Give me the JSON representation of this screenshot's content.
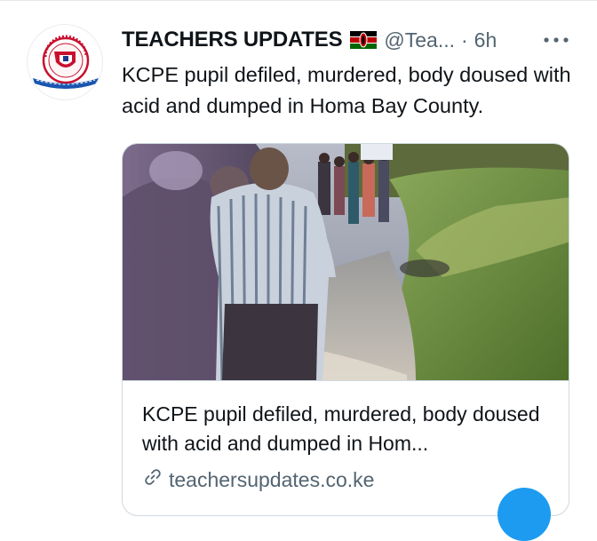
{
  "tweet": {
    "author_name": "TEACHERS UPDATES",
    "author_handle": "@Tea...",
    "separator": "·",
    "time": "6h",
    "text": "KCPE pupil defiled, murdered, body doused with acid and dumped in Homa Bay County.",
    "icons": {
      "flag": "kenya-flag-icon",
      "more": "more-options-icon",
      "link": "link-icon"
    },
    "card": {
      "title": "KCPE pupil defiled, murdered, body doused with acid and dumped in Hom...",
      "domain": "teachersupdates.co.ke"
    }
  },
  "colors": {
    "text_primary": "#0f1419",
    "text_secondary": "#536471",
    "border": "#cfd9de",
    "accent": "#1d9bf0"
  }
}
